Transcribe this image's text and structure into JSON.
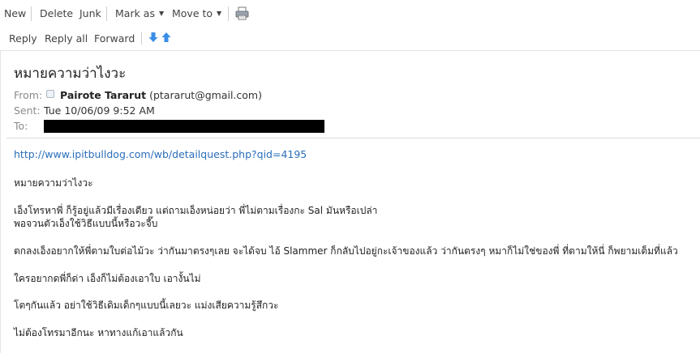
{
  "toolbar": {
    "new": "New",
    "delete": "Delete",
    "junk": "Junk",
    "mark_as": "Mark as",
    "move_to": "Move to"
  },
  "reply_toolbar": {
    "reply": "Reply",
    "reply_all": "Reply all",
    "forward": "Forward"
  },
  "message": {
    "subject": "หมายความว่าไงวะ",
    "from_label": "From:",
    "sender_name": "Pairote Tararut",
    "sender_email": "(ptararut@gmail.com)",
    "sent_label": "Sent:",
    "sent_value": "Tue 10/06/09 9:52 AM",
    "to_label": "To:",
    "link": "http://www.ipitbulldog.com/wb/detailquest.php?qid=4195",
    "body": [
      "หมายความว่าไงวะ",
      "เอ็งโทรหาพี่ ก็รู้อยู่แล้วมีเรื่องเดียว แต่ถามเอ็งหน่อยว่า พี่ไม่ตามเรื่องกะ Sal มันหรือเปล่า",
      "พอจวนตัวเอ็งใช้วิธีแบบนี้หรือวะจี๊บ",
      "ตกลงเอ็งอยากให้พี่ตามใบต่อไม้วะ ว่ากันมาตรงๆเลย จะได้จบ ไอ้ Slammer ก็กลับไปอยู่กะเจ้าของแล้ว ว่ากันตรงๆ หมาก็ไม่ใช่ของพี่ ที่ตามให้นี่ ก็พยามเต็มที่แล้ว",
      "ใครอยากดพี่ก็ด่า เอ็งก็ไม่ต้องเอาใบ เอางั้นไม่",
      "โตๆกันแล้ว อย่าใช้วิธีเดิมเด็กๆแบบนี้เลยวะ แม่งเสียความรู้สึกวะ",
      "ไม่ต้องโทรมาอีกนะ หาทางแก้เอาแล้วกัน"
    ]
  },
  "icons": {
    "print": "printer-icon",
    "next": "arrow-down-icon",
    "previous": "arrow-up-icon",
    "presence": "presence-icon"
  },
  "colors": {
    "link": "#2a6ebb",
    "nav_arrow": "#3a8ee6",
    "redaction": "#000000"
  }
}
